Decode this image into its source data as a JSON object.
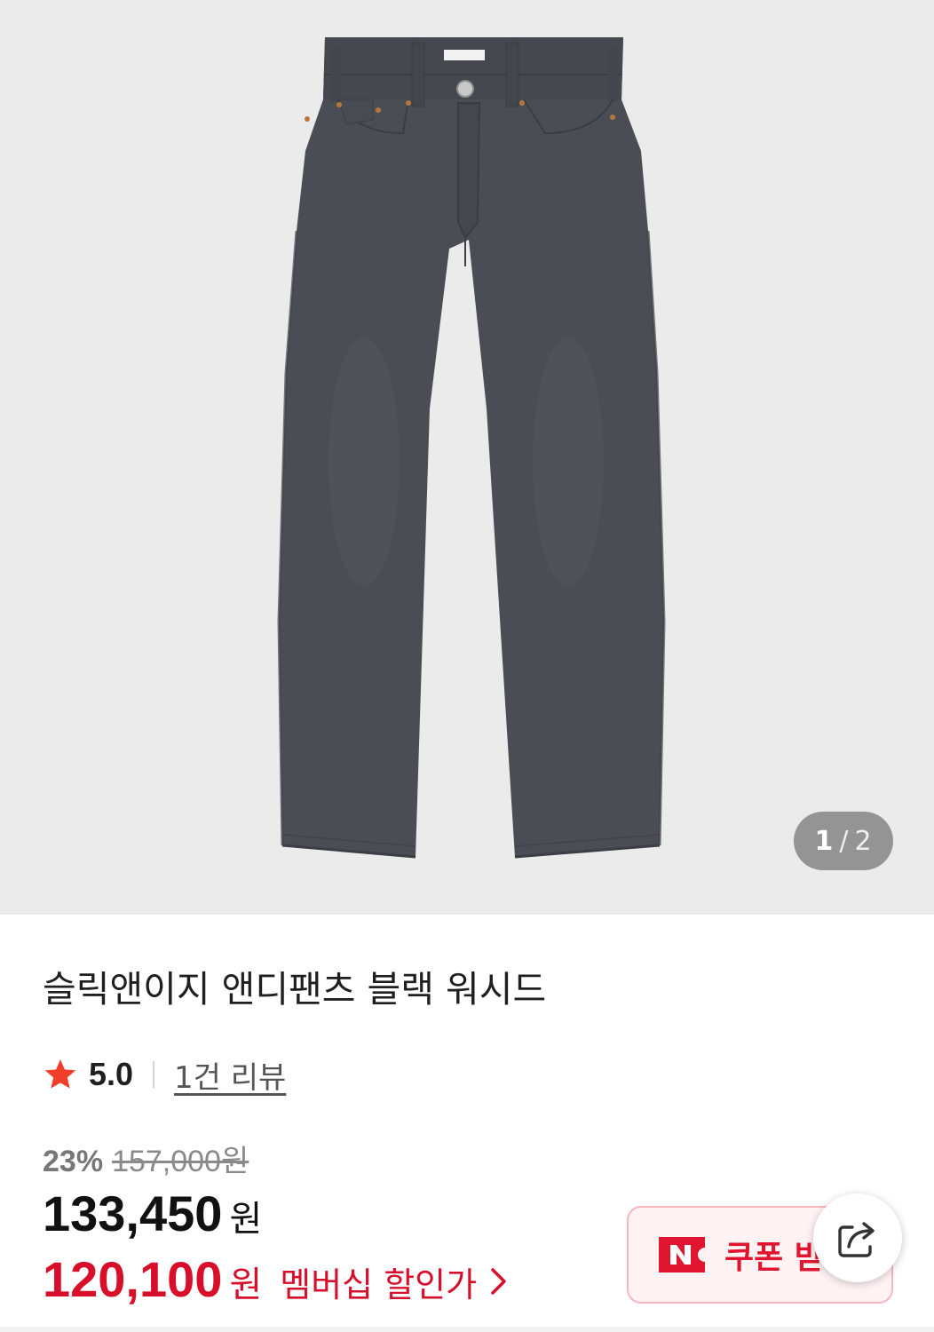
{
  "gallery": {
    "current": "1",
    "separator": "/",
    "total": "2",
    "image_subject": "jeans-image"
  },
  "product": {
    "title": "슬릭앤이지 앤디팬츠 블랙 워시드",
    "rating": "5.0",
    "review_link": "1건 리뷰",
    "discount_rate": "23%",
    "original_price": "157,000원",
    "price": "133,450",
    "price_unit": "원",
    "member_price": "120,100",
    "member_price_unit": "원",
    "member_label": "멤버십 할인가"
  },
  "coupon": {
    "badge": "N",
    "label": "쿠폰 받기"
  },
  "colors": {
    "accent_red": "#d80f2b",
    "star": "#f03e2a",
    "coupon_bg": "#fff3f4",
    "coupon_border": "#f6b7bf",
    "gallery_bg": "#ebebeb"
  },
  "icons": {
    "star": "star-icon",
    "chevron": "chevron-right-icon",
    "share": "share-icon",
    "coupon_badge": "naver-n-icon"
  }
}
